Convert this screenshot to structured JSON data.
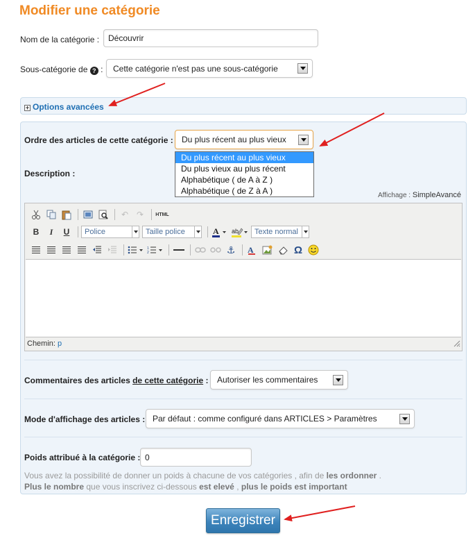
{
  "title": "Modifier une catégorie",
  "name_field": {
    "label": "Nom de la catégorie :",
    "value": "Découvrir"
  },
  "subcategory": {
    "label": "Sous-catégorie de",
    "help_icon": "question-mark-icon",
    "selected": "Cette catégorie n'est pas une sous-catégorie"
  },
  "advanced": {
    "expand_icon": "plus-box-icon",
    "label": "Options avancées"
  },
  "order": {
    "label": "Ordre des articles de cette catégorie :",
    "selected": "Du plus récent au plus vieux",
    "options": [
      "Du plus récent au plus vieux",
      "Du plus vieux au plus récent",
      "Alphabétique ( de A à Z )",
      "Alphabétique ( de Z à A )"
    ]
  },
  "description": {
    "label": "Description :",
    "display_label": "Affichage :",
    "display_modes": [
      "Simple",
      "Avancé"
    ]
  },
  "editor": {
    "font_select": "Police",
    "size_select": "Taille police",
    "format_select": "Texte normal",
    "html_label": "HTML",
    "bold": "B",
    "italic": "I",
    "underline": "U",
    "status_label": "Chemin:",
    "status_path": "p"
  },
  "comments": {
    "label_pre": "Commentaires des articles",
    "label_link": "de cette catégorie",
    "label_post": ":",
    "selected": "Autoriser les commentaires"
  },
  "display_mode": {
    "label": "Mode d'affichage des articles :",
    "selected": "Par défaut : comme configuré dans ARTICLES > Paramètres"
  },
  "weight": {
    "label": "Poids attribué à la catégorie :",
    "value": "0",
    "hint1_pre": "Vous avez la possibilité de donner un poids à chacune de vos catégories , afin de",
    "hint1_bold": "les ordonner",
    "hint1_post": ".",
    "hint2_b1": "Plus le nombre",
    "hint2_mid": "que vous inscrivez ci-dessous",
    "hint2_b2": "est elevé",
    "hint2_sep": ",",
    "hint2_b3": "plus le poids est important"
  },
  "save_button": "Enregistrer",
  "colors": {
    "title": "#f08a24",
    "link": "#1f6fb3",
    "panel_bg": "#eef4fa",
    "selected_option": "#3399ff",
    "annotation_arrow": "#e0201f"
  }
}
